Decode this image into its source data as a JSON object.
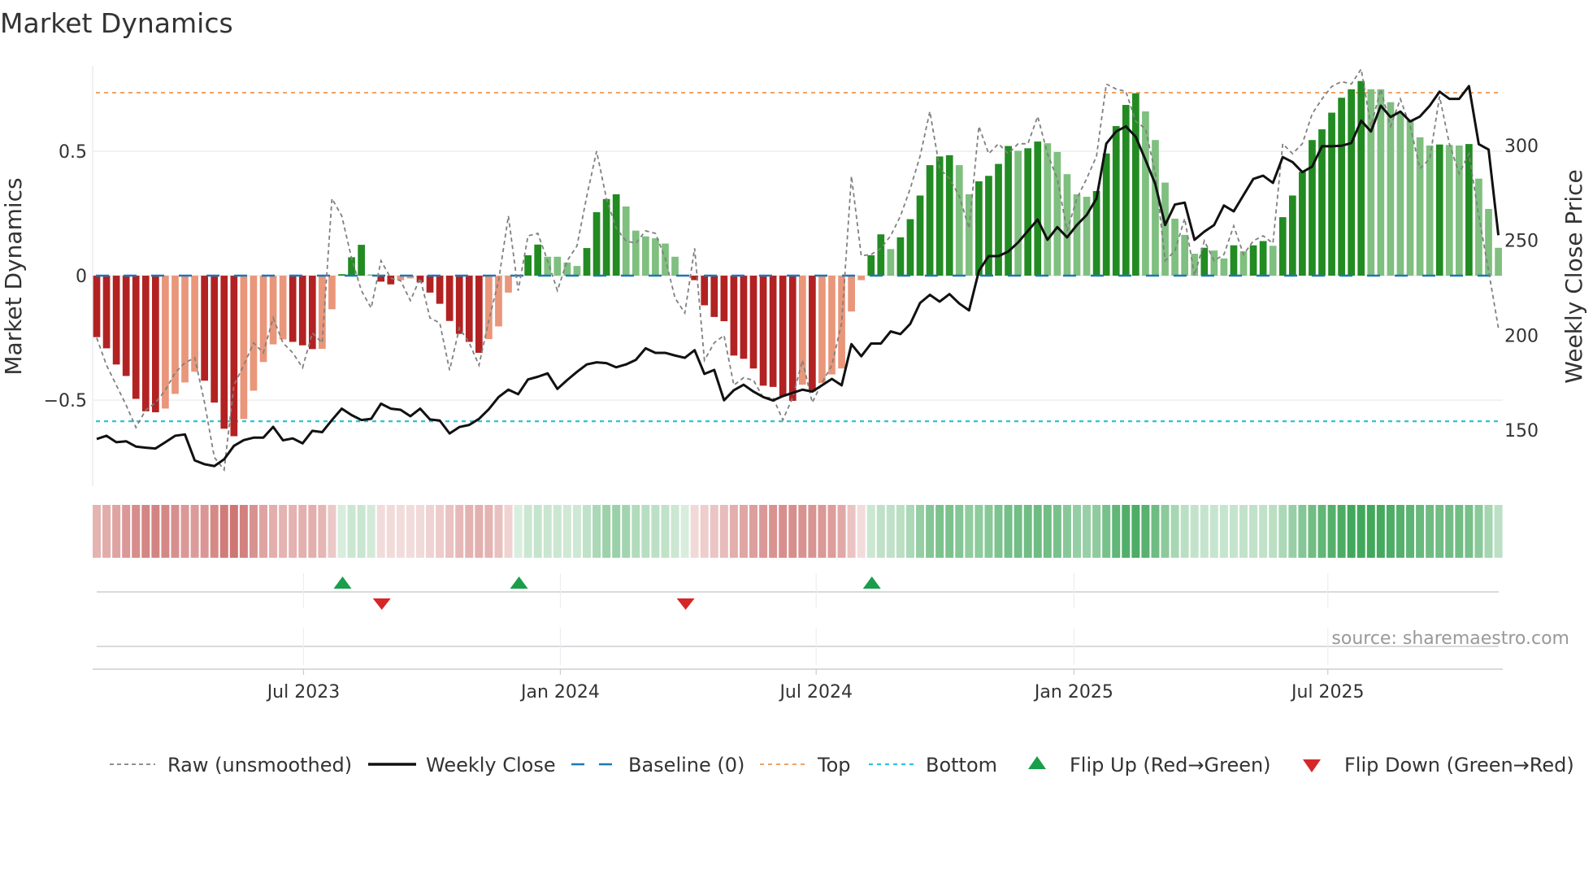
{
  "title": "Market Dynamics",
  "source": "source: sharemaestro.com",
  "colors": {
    "bar_neg_strong": "#b22222",
    "bar_neg_weak": "#e9967a",
    "bar_pos_strong": "#228b22",
    "bar_pos_weak": "#7fbf7f",
    "raw": "#808080",
    "close": "#111111",
    "baseline": "#1f77b4",
    "top": "#f4a261",
    "bottom": "#2ec4d6",
    "flip_up": "#1a9e4a",
    "flip_down": "#d62728",
    "heat_neg": "#c0504d",
    "heat_pos": "#2e9e4a"
  },
  "legend": [
    {
      "key": "raw",
      "label": "Raw (unsmoothed)"
    },
    {
      "key": "close",
      "label": "Weekly Close"
    },
    {
      "key": "baseline",
      "label": "Baseline (0)"
    },
    {
      "key": "top",
      "label": "Top"
    },
    {
      "key": "bottom",
      "label": "Bottom"
    },
    {
      "key": "flip_up",
      "label": "Flip Up (Red→Green)"
    },
    {
      "key": "flip_down",
      "label": "Flip Down (Green→Red)"
    }
  ],
  "chart_data": {
    "type": "bar",
    "title": "Market Dynamics",
    "ylabel": "Market Dynamics",
    "y2label": "Weekly Close Price",
    "ylim": [
      -0.846,
      0.843
    ],
    "y2lim": [
      120.4,
      342
    ],
    "yticks": [
      {
        "v": 0.5,
        "label": "0.5"
      },
      {
        "v": 0,
        "label": "0"
      },
      {
        "v": -0.5,
        "label": "−0.5"
      }
    ],
    "y2ticks": [
      {
        "v": 300,
        "label": "300"
      },
      {
        "v": 250,
        "label": "250"
      },
      {
        "v": 200,
        "label": "200"
      },
      {
        "v": 150,
        "label": "150"
      }
    ],
    "xlim": [
      0,
      143
    ],
    "xticks": [
      {
        "week": 21.1,
        "label": "Jul 2023"
      },
      {
        "week": 47.3,
        "label": "Jan 2024"
      },
      {
        "week": 73.4,
        "label": "Jul 2024"
      },
      {
        "week": 99.7,
        "label": "Jan 2025"
      },
      {
        "week": 125.6,
        "label": "Jul 2025"
      }
    ],
    "top_level": 0.735,
    "bottom_level": -0.585,
    "baseline": 0,
    "values": [
      -0.247,
      -0.292,
      -0.357,
      -0.403,
      -0.495,
      -0.545,
      -0.549,
      -0.534,
      -0.475,
      -0.429,
      -0.386,
      -0.422,
      -0.51,
      -0.615,
      -0.645,
      -0.576,
      -0.462,
      -0.347,
      -0.276,
      -0.256,
      -0.266,
      -0.28,
      -0.295,
      -0.294,
      -0.135,
      0.006,
      0.074,
      0.124,
      0.005,
      -0.024,
      -0.035,
      -0.018,
      -0.011,
      -0.027,
      -0.068,
      -0.113,
      -0.182,
      -0.234,
      -0.266,
      -0.31,
      -0.255,
      -0.204,
      -0.068,
      0.0,
      0.082,
      0.125,
      0.076,
      0.076,
      0.053,
      0.039,
      0.111,
      0.255,
      0.308,
      0.327,
      0.278,
      0.181,
      0.158,
      0.15,
      0.129,
      0.076,
      0.0,
      -0.018,
      -0.119,
      -0.166,
      -0.183,
      -0.321,
      -0.334,
      -0.373,
      -0.442,
      -0.447,
      -0.484,
      -0.503,
      -0.438,
      -0.465,
      -0.432,
      -0.397,
      -0.373,
      -0.144,
      -0.018,
      0.082,
      0.166,
      0.107,
      0.154,
      0.227,
      0.322,
      0.444,
      0.479,
      0.484,
      0.444,
      0.327,
      0.379,
      0.401,
      0.449,
      0.521,
      0.502,
      0.512,
      0.539,
      0.532,
      0.497,
      0.408,
      0.327,
      0.317,
      0.34,
      0.491,
      0.601,
      0.686,
      0.733,
      0.66,
      0.545,
      0.374,
      0.229,
      0.164,
      0.088,
      0.112,
      0.101,
      0.069,
      0.122,
      0.098,
      0.122,
      0.139,
      0.12,
      0.235,
      0.322,
      0.417,
      0.545,
      0.588,
      0.655,
      0.715,
      0.749,
      0.782,
      0.749,
      0.749,
      0.697,
      0.651,
      0.624,
      0.556,
      0.523,
      0.527,
      0.525,
      0.523,
      0.529,
      0.39,
      0.268,
      0.112
    ],
    "strong": [
      1,
      1,
      1,
      1,
      1,
      1,
      1,
      0,
      0,
      0,
      0,
      1,
      1,
      1,
      1,
      0,
      0,
      0,
      0,
      0,
      1,
      1,
      1,
      0,
      0,
      1,
      1,
      1,
      0,
      1,
      1,
      0,
      0,
      1,
      1,
      1,
      1,
      1,
      1,
      1,
      0,
      0,
      0,
      0,
      1,
      1,
      0,
      0,
      0,
      0,
      1,
      1,
      1,
      1,
      0,
      0,
      0,
      0,
      0,
      0,
      0,
      1,
      1,
      1,
      1,
      1,
      1,
      1,
      1,
      1,
      1,
      1,
      0,
      1,
      0,
      0,
      0,
      0,
      0,
      1,
      1,
      0,
      1,
      1,
      1,
      1,
      1,
      1,
      0,
      0,
      1,
      1,
      1,
      1,
      0,
      1,
      1,
      0,
      0,
      0,
      0,
      0,
      1,
      1,
      1,
      1,
      1,
      0,
      0,
      0,
      0,
      0,
      0,
      1,
      0,
      0,
      1,
      0,
      1,
      1,
      0,
      1,
      1,
      1,
      1,
      1,
      1,
      1,
      1,
      1,
      0,
      0,
      0,
      0,
      0,
      0,
      0,
      1,
      0,
      0,
      1,
      0,
      0,
      0
    ],
    "raw": [
      -0.25,
      -0.36,
      -0.44,
      -0.52,
      -0.61,
      -0.54,
      -0.51,
      -0.46,
      -0.39,
      -0.35,
      -0.33,
      -0.51,
      -0.73,
      -0.78,
      -0.44,
      -0.36,
      -0.27,
      -0.31,
      -0.17,
      -0.27,
      -0.31,
      -0.37,
      -0.23,
      -0.27,
      0.31,
      0.24,
      0.07,
      -0.06,
      -0.13,
      0.06,
      -0.01,
      -0.02,
      -0.1,
      -0.01,
      -0.17,
      -0.19,
      -0.38,
      -0.21,
      -0.27,
      -0.36,
      -0.18,
      -0.02,
      0.24,
      -0.06,
      0.16,
      0.17,
      0.06,
      -0.06,
      0.06,
      0.12,
      0.32,
      0.5,
      0.31,
      0.19,
      0.14,
      0.13,
      0.18,
      0.17,
      0.07,
      -0.09,
      -0.15,
      0.11,
      -0.34,
      -0.27,
      -0.24,
      -0.44,
      -0.41,
      -0.42,
      -0.49,
      -0.49,
      -0.58,
      -0.49,
      -0.34,
      -0.51,
      -0.43,
      -0.36,
      -0.19,
      0.4,
      0.08,
      0.085,
      0.11,
      0.16,
      0.24,
      0.35,
      0.48,
      0.66,
      0.43,
      0.39,
      0.32,
      0.19,
      0.6,
      0.49,
      0.53,
      0.49,
      0.53,
      0.53,
      0.64,
      0.49,
      0.39,
      0.18,
      0.31,
      0.39,
      0.48,
      0.77,
      0.75,
      0.74,
      0.62,
      0.59,
      0.41,
      0.06,
      0.1,
      0.23,
      0.0,
      0.14,
      0.06,
      0.085,
      0.2,
      0.085,
      0.14,
      0.16,
      0.13,
      0.53,
      0.49,
      0.53,
      0.65,
      0.71,
      0.76,
      0.78,
      0.77,
      0.83,
      0.6,
      0.75,
      0.6,
      0.71,
      0.6,
      0.43,
      0.47,
      0.72,
      0.53,
      0.41,
      0.49,
      0.24,
      0.02,
      -0.21
    ],
    "close": [
      145.3,
      147,
      143.6,
      144.1,
      141.3,
      140.7,
      140.3,
      143.6,
      147,
      147.7,
      134,
      132,
      131,
      134.6,
      141.7,
      144.7,
      146,
      146,
      151.7,
      144.6,
      145.6,
      143,
      149.6,
      148.9,
      155.3,
      161.3,
      157.9,
      155.3,
      155.9,
      163.9,
      161.3,
      160.7,
      157.3,
      161.3,
      155.6,
      155,
      148.2,
      151.6,
      152.7,
      155.9,
      161,
      167.4,
      171.3,
      168.9,
      176.7,
      178.1,
      179.9,
      171.7,
      176.4,
      180.7,
      184.6,
      185.7,
      185.3,
      183.1,
      184.6,
      187,
      193.1,
      190.7,
      190.7,
      189.3,
      188.1,
      192.1,
      179.6,
      181.7,
      165.7,
      171,
      173.9,
      170.3,
      167.4,
      165.6,
      167.9,
      169.6,
      171.3,
      170.3,
      173.6,
      177,
      173.6,
      195.3,
      188.9,
      195.6,
      195.6,
      202,
      200.6,
      206,
      217,
      221.3,
      217.7,
      221.7,
      216.7,
      213.1,
      233.9,
      241.7,
      241.7,
      244.1,
      248.9,
      255,
      261,
      250.3,
      257,
      251.6,
      258.1,
      263.4,
      272.1,
      301,
      307.4,
      310.1,
      304.6,
      292.4,
      279.6,
      258.1,
      268.9,
      269.9,
      250.3,
      254.6,
      258.1,
      268.4,
      265.3,
      273.9,
      282.4,
      284.1,
      280.3,
      293.9,
      291.3,
      286,
      288.9,
      299.6,
      299.6,
      299.9,
      301.3,
      313.1,
      307.4,
      321,
      315,
      317.9,
      312.7,
      315.3,
      321,
      328.4,
      324.6,
      324.6,
      331.3,
      300.7,
      297.9,
      252.7
    ],
    "flips_up": [
      25,
      43,
      79
    ],
    "flips_down": [
      29,
      60
    ]
  }
}
